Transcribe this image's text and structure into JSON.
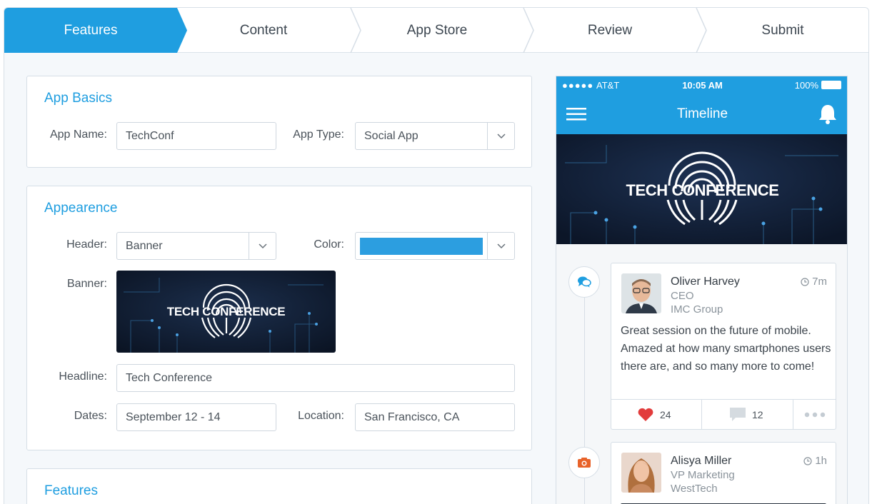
{
  "steps": [
    "Features",
    "Content",
    "App Store",
    "Review",
    "Submit"
  ],
  "app_basics": {
    "title": "App Basics",
    "app_name_label": "App Name:",
    "app_name_value": "TechConf",
    "app_type_label": "App Type:",
    "app_type_value": "Social App"
  },
  "appearance": {
    "title": "Appearence",
    "header_label": "Header:",
    "header_value": "Banner",
    "color_label": "Color:",
    "color_value": "#2c9ee0",
    "banner_label": "Banner:",
    "banner_text": "TECH CONFERENCE",
    "headline_label": "Headline:",
    "headline_value": "Tech Conference",
    "dates_label": "Dates:",
    "dates_value": "September 12 - 14",
    "location_label": "Location:",
    "location_value": "San Francisco, CA"
  },
  "features": {
    "title": "Features"
  },
  "phone": {
    "carrier": "AT&T",
    "time": "10:05 AM",
    "battery": "100%",
    "nav_title": "Timeline",
    "banner_text": "TECH CONFERENCE",
    "posts": [
      {
        "name": "Oliver Harvey",
        "role": "CEO",
        "company": "IMC Group",
        "time": "7m",
        "message": "Great session on the future of mobile. Amazed at how many smartphones users there are, and so many more to come!",
        "likes": "24",
        "comments": "12"
      },
      {
        "name": "Alisya Miller",
        "role": "VP Marketing",
        "company": "WestTech",
        "time": "1h"
      }
    ]
  },
  "colors": {
    "accent": "#1f9ee0",
    "like": "#e23b3b",
    "camera": "#e8632a"
  }
}
